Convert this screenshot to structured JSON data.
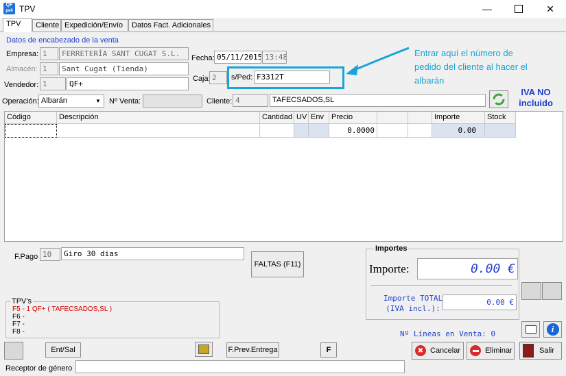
{
  "window": {
    "title": "TPV",
    "icon_text": "QF",
    "icon_sub": "pell"
  },
  "tabs": [
    "TPV",
    "Cliente",
    "Expedición/Envío",
    "Datos Fact. Adicionales"
  ],
  "header": {
    "section_title": "Datos de encabezado de la venta",
    "empresa_label": "Empresa:",
    "empresa_code": "1",
    "empresa_name": "FERRETERÍA SANT CUGAT S.L.",
    "almacen_label": "Almacén:",
    "almacen_code": "1",
    "almacen_name": "Sant Cugat (Tienda)",
    "vendedor_label": "Vendedor:",
    "vendedor_code": "1",
    "vendedor_name": "QF+",
    "fecha_label": "Fecha:",
    "fecha": "05/11/2015",
    "hora": "13:48",
    "caja_label": "Caja:",
    "caja": "2",
    "sped_label": "s/Ped:",
    "sped": "F3312T",
    "operacion_label": "Operación:",
    "operacion": "Albarán",
    "nventa_label": "Nº Venta:",
    "nventa": "",
    "cliente_label": "Cliente:",
    "cliente_code": "4",
    "cliente_name": "TAFECSADOS,SL"
  },
  "annotation": {
    "callout_text": "Entrar aquí el número de pedido del cliente al hacer el albarán",
    "iva_note": "IVA NO incluido"
  },
  "grid": {
    "columns": [
      "Código",
      "Descripción",
      "Cantidad",
      "UV",
      "Env",
      "Precio",
      "",
      "",
      "Importe",
      "Stock"
    ],
    "row": {
      "codigo": "",
      "descripcion": "",
      "cantidad": "",
      "uv": "",
      "env": "",
      "precio": "0.0000",
      "c7": "",
      "c8": "",
      "importe": "0.00",
      "stock": ""
    }
  },
  "footer": {
    "fpago_label": "F.Pago",
    "fpago_code": "10",
    "fpago_desc": "Giro 30 dias",
    "faltas_button": "FALTAS (F11)",
    "tpvs_title": "TPV's",
    "tpv_lines": [
      "F5 - 1 QF+ ( TAFECSADOS,SL )",
      "F6 -",
      "F7 -",
      "F8 -"
    ],
    "ent_sal_button": "Ent/Sal",
    "fprev_button": "F.Prev.Entrega",
    "f_button": "F",
    "receptor_label": "Receptor de género",
    "receptor_value": ""
  },
  "importes": {
    "title": "Importes",
    "importe_label": "Importe:",
    "importe_value": "0.00 €",
    "total_label_1": "Importe TOTAL",
    "total_label_2": "(IVA incl.):",
    "total_value": "0.00 €",
    "lineas_text": "Nº Líneas en Venta: 0"
  },
  "actions": {
    "cancelar": "Cancelar",
    "eliminar": "Eliminar",
    "salir": "Salir"
  },
  "colors": {
    "annotation_blue": "#1aa3d9",
    "accent_blue": "#1f3fcf",
    "tpv_red": "#d40000"
  }
}
